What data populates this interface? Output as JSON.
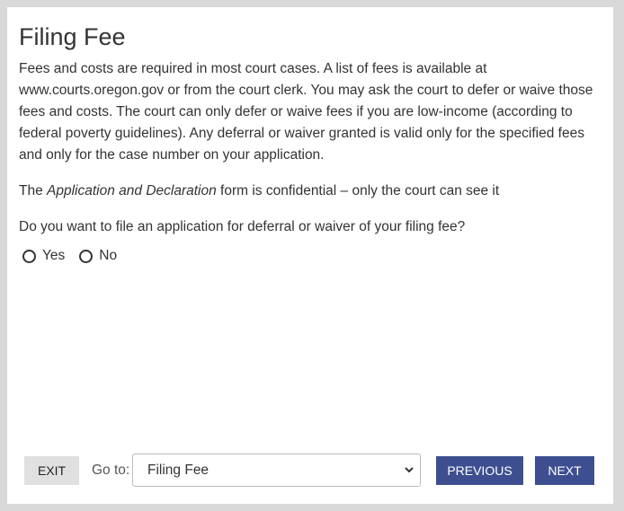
{
  "page": {
    "title": "Filing Fee",
    "paragraph1": "Fees and costs are required in most court cases. A list of fees is available at www.courts.oregon.gov or from the court clerk. You may ask the court to defer or waive those fees and costs. The court can only defer or waive fees if you are low-income (according to federal poverty guidelines). Any deferral or waiver granted is valid only for the specified fees and only for the case number on your application.",
    "paragraph2_prefix": "The ",
    "paragraph2_emphasis": "Application and Declaration",
    "paragraph2_suffix": " form is confidential – only the court can see it",
    "question": "Do you want to file an application for deferral or waiver of your filing fee?"
  },
  "options": {
    "yes_label": "Yes",
    "no_label": "No",
    "selected": ""
  },
  "footer": {
    "exit_label": "EXIT",
    "goto_label": "Go to:",
    "goto_value": "Filing Fee",
    "previous_label": "PREVIOUS",
    "next_label": "NEXT"
  },
  "colors": {
    "primary_button": "#3d4f91",
    "secondary_button": "#e0e0e0",
    "background": "#d9d9d9"
  }
}
